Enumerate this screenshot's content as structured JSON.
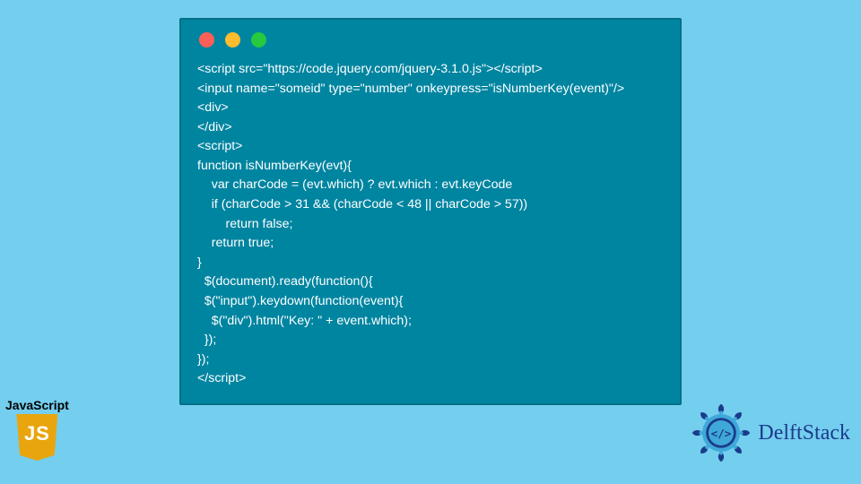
{
  "window": {
    "dots": [
      "red",
      "yellow",
      "green"
    ]
  },
  "code_lines": [
    "<script src=\"https://code.jquery.com/jquery-3.1.0.js\"></script>",
    "<input name=\"someid\" type=\"number\" onkeypress=\"isNumberKey(event)\"/>",
    "<div>",
    "</div>",
    "<script>",
    "function isNumberKey(evt){",
    "    var charCode = (evt.which) ? evt.which : evt.keyCode",
    "    if (charCode > 31 && (charCode < 48 || charCode > 57))",
    "        return false;",
    "    return true;",
    "}",
    "  $(document).ready(function(){",
    "  $(\"input\").keydown(function(event){",
    "    $(\"div\").html(\"Key: \" + event.which);",
    "  });",
    "});",
    "</script>"
  ],
  "js_badge": {
    "label": "JavaScript",
    "logo_text": "JS"
  },
  "brand": {
    "name": "DelftStack"
  }
}
